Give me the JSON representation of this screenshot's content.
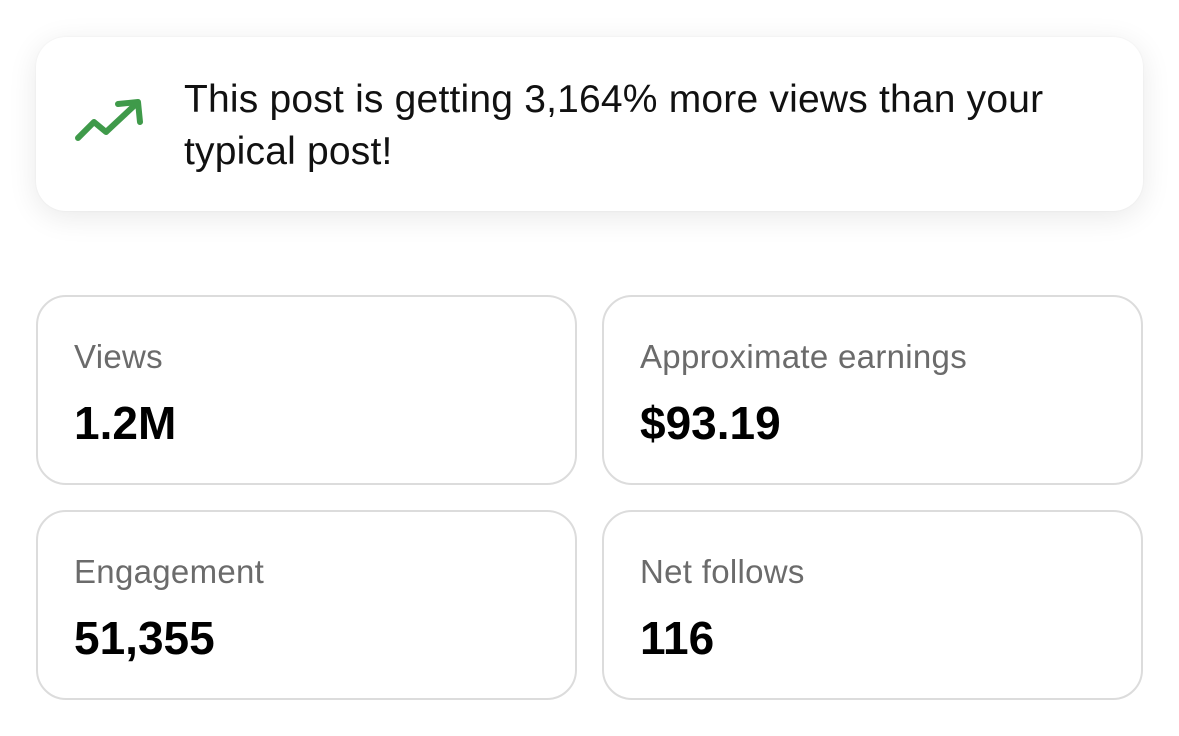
{
  "banner": {
    "icon": "trending-up-icon",
    "icon_color": "#3f9a4a",
    "message": "This post is getting 3,164% more views than your typical post!"
  },
  "stats": [
    {
      "label": "Views",
      "value": "1.2M"
    },
    {
      "label": "Approximate earnings",
      "value": "$93.19"
    },
    {
      "label": "Engagement",
      "value": "51,355"
    },
    {
      "label": "Net follows",
      "value": "116"
    }
  ]
}
